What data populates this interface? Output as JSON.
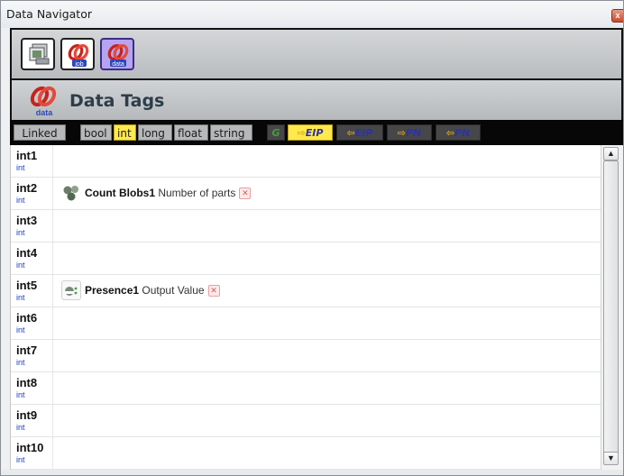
{
  "window": {
    "title": "Data Navigator",
    "close_glyph": "x"
  },
  "toolbar": {
    "buttons": [
      {
        "icon": "image-stack-icon"
      },
      {
        "icon": "job-link-icon",
        "label": "job"
      },
      {
        "icon": "data-link-icon",
        "label": "data",
        "active": true
      }
    ]
  },
  "header": {
    "title": "Data Tags",
    "logo_label": "data"
  },
  "filters": {
    "linked": "Linked",
    "types": [
      "bool",
      "int",
      "long",
      "float",
      "string"
    ],
    "selected_type": "int",
    "protocols": [
      {
        "label": "G"
      },
      {
        "label": "EIP",
        "arrow": "⇨"
      },
      {
        "label": "EIP",
        "arrow": "⇦"
      },
      {
        "label": "PN",
        "arrow": "⇨"
      },
      {
        "label": "PN",
        "arrow": "⇦"
      }
    ],
    "selected_protocol_index": 1
  },
  "rows": [
    {
      "name": "int1",
      "type": "int"
    },
    {
      "name": "int2",
      "type": "int",
      "link": {
        "tool": "Count Blobs1",
        "value": "Number of parts"
      }
    },
    {
      "name": "int3",
      "type": "int"
    },
    {
      "name": "int4",
      "type": "int"
    },
    {
      "name": "int5",
      "type": "int",
      "link": {
        "tool": "Presence1",
        "value": "Output Value"
      }
    },
    {
      "name": "int6",
      "type": "int"
    },
    {
      "name": "int7",
      "type": "int"
    },
    {
      "name": "int8",
      "type": "int"
    },
    {
      "name": "int9",
      "type": "int"
    },
    {
      "name": "int10",
      "type": "int"
    }
  ],
  "colors": {
    "selected": "#ffe94d",
    "active_button": "#b7a4ee",
    "type_text": "#2040c0",
    "remove": "#e05a5a"
  }
}
